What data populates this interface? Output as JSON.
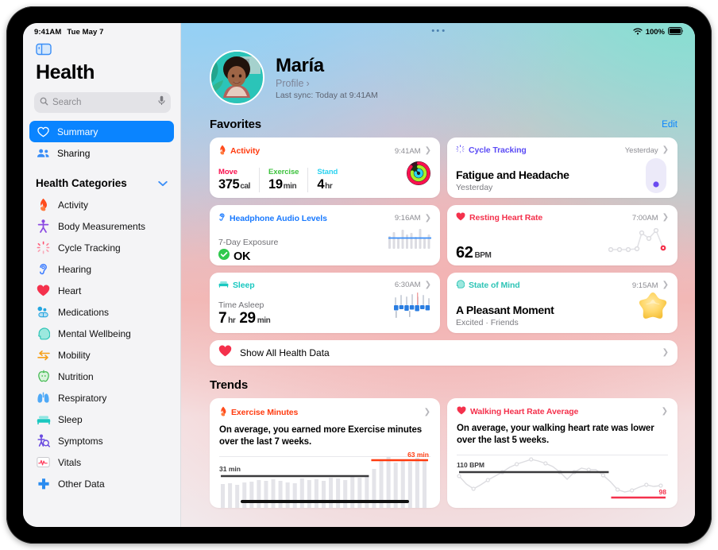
{
  "status": {
    "time": "9:41AM",
    "date": "Tue May 7",
    "battery": "100%",
    "wifi_icon": "wifi-icon",
    "battery_icon": "battery-icon"
  },
  "sidebar": {
    "toggle_icon": "sidebar-toggle-icon",
    "title": "Health",
    "search": {
      "placeholder": "Search",
      "search_icon": "search-icon",
      "mic_icon": "microphone-icon"
    },
    "nav": [
      {
        "label": "Summary",
        "icon": "heart-outline-icon",
        "active": true
      },
      {
        "label": "Sharing",
        "icon": "people-icon",
        "active": false
      }
    ],
    "group": {
      "label": "Health Categories",
      "chevron_icon": "chevron-down-icon"
    },
    "categories": [
      {
        "label": "Activity",
        "icon": "flame-icon",
        "color": "#ff4c1d"
      },
      {
        "label": "Body Measurements",
        "icon": "body-figure-icon",
        "color": "#8b4ae2"
      },
      {
        "label": "Cycle Tracking",
        "icon": "cycle-dots-icon",
        "color": "#ff4f6e"
      },
      {
        "label": "Hearing",
        "icon": "ear-icon",
        "color": "#3a7bff"
      },
      {
        "label": "Heart",
        "icon": "heart-filled-icon",
        "color": "#f4314c"
      },
      {
        "label": "Medications",
        "icon": "pills-icon",
        "color": "#25a6e0"
      },
      {
        "label": "Mental Wellbeing",
        "icon": "head-icon",
        "color": "#2ec4b6"
      },
      {
        "label": "Mobility",
        "icon": "mobility-arrows-icon",
        "color": "#f6a01a"
      },
      {
        "label": "Nutrition",
        "icon": "apple-icon",
        "color": "#3db84b"
      },
      {
        "label": "Respiratory",
        "icon": "lungs-icon",
        "color": "#3a9bf4"
      },
      {
        "label": "Sleep",
        "icon": "bed-icon",
        "color": "#19c8c0"
      },
      {
        "label": "Symptoms",
        "icon": "symptoms-person-icon",
        "color": "#6b4ce0"
      },
      {
        "label": "Vitals",
        "icon": "vitals-pulse-icon",
        "color": "#ff3b5c"
      },
      {
        "label": "Other Data",
        "icon": "plus-cross-icon",
        "color": "#2a8cf0"
      }
    ]
  },
  "profile": {
    "avatar": "user-avatar",
    "name": "María",
    "profile_link": "Profile",
    "chevron": "›",
    "last_sync": "Last sync: Today at 9:41AM"
  },
  "favorites": {
    "title": "Favorites",
    "edit_label": "Edit",
    "cards": [
      {
        "category": "Activity",
        "category_color": "#ff3b0f",
        "icon": "flame-icon",
        "time": "9:41AM",
        "type": "metrics",
        "metrics": [
          {
            "label": "Move",
            "color": "#fa114f",
            "value": "375",
            "unit": "cal"
          },
          {
            "label": "Exercise",
            "color": "#3ec23e",
            "value": "19",
            "unit": "min"
          },
          {
            "label": "Stand",
            "color": "#2ad2f0",
            "value": "4",
            "unit": "hr"
          }
        ],
        "visual": "activity-rings"
      },
      {
        "category": "Cycle Tracking",
        "category_color": "#5b4bf5",
        "icon": "cycle-dots-icon",
        "time": "Yesterday",
        "type": "title-sub",
        "title": "Fatigue and Headache",
        "subtitle": "Yesterday",
        "visual": "cycle-pill"
      },
      {
        "category": "Headphone Audio Levels",
        "category_color": "#1a7aff",
        "icon": "ear-icon",
        "time": "9:16AM",
        "type": "status",
        "label": "7-Day Exposure",
        "status_text": "OK",
        "status_icon": "check-circle-icon",
        "status_color": "#30c94e",
        "visual": "audio-bars"
      },
      {
        "category": "Resting Heart Rate",
        "category_color": "#f4314c",
        "icon": "heart-filled-icon",
        "time": "7:00AM",
        "type": "value",
        "value": "62",
        "unit": "BPM",
        "visual": "hr-sparkline"
      },
      {
        "category": "Sleep",
        "category_color": "#19c8c0",
        "icon": "bed-icon",
        "time": "6:30AM",
        "type": "duration",
        "label": "Time Asleep",
        "hours": "7",
        "hours_unit": "hr",
        "minutes": "29",
        "minutes_unit": "min",
        "visual": "sleep-bars"
      },
      {
        "category": "State of Mind",
        "category_color": "#2ec4b6",
        "icon": "head-icon",
        "time": "9:15AM",
        "type": "title-sub",
        "title": "A Pleasant Moment",
        "subtitle": "Excited · Friends",
        "visual": "star-blob"
      }
    ],
    "show_all": {
      "label": "Show All Health Data",
      "icon": "heart-filled-icon"
    }
  },
  "trends": {
    "title": "Trends",
    "cards": [
      {
        "category": "Exercise Minutes",
        "category_color": "#ff3b0f",
        "icon": "flame-icon",
        "description": "On average, you earned more Exercise minutes over the last 7 weeks."
      },
      {
        "category": "Walking Heart Rate Average",
        "category_color": "#f4314c",
        "icon": "heart-filled-icon",
        "description": "On average, your walking heart rate was lower over the last 5 weeks."
      }
    ]
  },
  "chart_data": [
    {
      "type": "bar",
      "title": "Exercise Minutes",
      "baseline_label": "31 min",
      "baseline_value": 31,
      "highlight_label": "63 min",
      "highlight_value": 63,
      "baseline_color": "#3a3a3c",
      "highlight_color": "#ff3b0f",
      "bar_color": "#e3e3e8",
      "ylabel": "minutes",
      "values": [
        26,
        27,
        25,
        28,
        29,
        31,
        30,
        32,
        30,
        28,
        27,
        33,
        31,
        32,
        30,
        34,
        33,
        31,
        35,
        34,
        36,
        52,
        62,
        68,
        60,
        64,
        61,
        67,
        63
      ],
      "highlight_start_index": 21
    },
    {
      "type": "line",
      "title": "Walking Heart Rate Average",
      "baseline_label": "110 BPM",
      "baseline_value": 110,
      "highlight_label": "98",
      "highlight_value": 98,
      "baseline_color": "#3a3a3c",
      "highlight_color": "#f4314c",
      "line_color": "#dcdce0",
      "ylabel": "BPM",
      "values": [
        106,
        100,
        97,
        101,
        104,
        106,
        108,
        110,
        113,
        114,
        116,
        115,
        114,
        112,
        108,
        103,
        108,
        111,
        110,
        110,
        106,
        101,
        96,
        95,
        96,
        98,
        99,
        98
      ],
      "highlight_start_index": 22
    }
  ]
}
